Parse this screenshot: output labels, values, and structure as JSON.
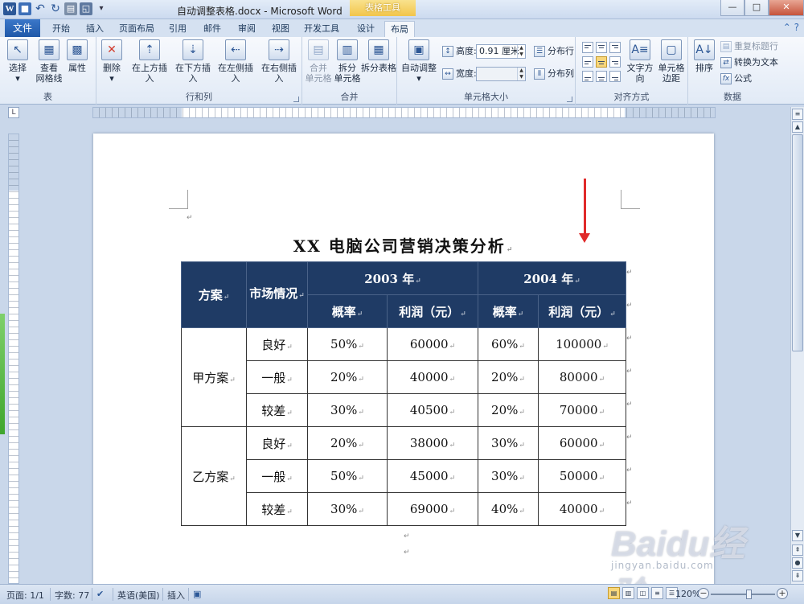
{
  "titlebar": {
    "title": "自动调整表格.docx - Microsoft Word",
    "contextual_tools": "表格工具",
    "app_logo": "W",
    "controls": [
      "—",
      "□",
      "✕"
    ]
  },
  "tabs": {
    "file": "文件",
    "items": [
      "开始",
      "插入",
      "页面布局",
      "引用",
      "邮件",
      "审阅",
      "视图",
      "开发工具",
      "设计",
      "布局"
    ],
    "active": "布局"
  },
  "ribbon": {
    "table": {
      "label": "表",
      "select": "选择",
      "gridlines_l1": "查看",
      "gridlines_l2": "网格线",
      "properties": "属性"
    },
    "rows_cols": {
      "label": "行和列",
      "delete": "删除",
      "insert_above": "在上方插入",
      "insert_below": "在下方插入",
      "insert_left": "在左侧插入",
      "insert_right": "在右侧插入"
    },
    "merge": {
      "label": "合并",
      "merge_cells_l1": "合并",
      "merge_cells_l2": "单元格",
      "split_cells_l1": "拆分",
      "split_cells_l2": "单元格",
      "split_table": "拆分表格"
    },
    "cell_size": {
      "label": "单元格大小",
      "autofit": "自动调整",
      "height_label": "高度:",
      "height_value": "0.91 厘米",
      "width_label": "宽度:",
      "width_value": "",
      "distribute_rows": "分布行",
      "distribute_cols": "分布列"
    },
    "alignment": {
      "label": "对齐方式",
      "text_direction": "文字方向",
      "cell_margins_l1": "单元格",
      "cell_margins_l2": "边距"
    },
    "data": {
      "label": "数据",
      "sort": "排序",
      "repeat_header": "重复标题行",
      "convert_text": "转换为文本",
      "formula": "公式"
    }
  },
  "document": {
    "title": "XX 电脑公司营销决策分析",
    "table": {
      "header_top": [
        "方案",
        "市场情况",
        "2003 年",
        "2004 年"
      ],
      "header_sub": [
        "概率",
        "利润（元）",
        "概率",
        "利润（元）"
      ],
      "groups": [
        {
          "plan": "甲方案",
          "rows": [
            [
              "良好",
              "50%",
              "60000",
              "60%",
              "100000"
            ],
            [
              "一般",
              "20%",
              "40000",
              "20%",
              "80000"
            ],
            [
              "较差",
              "30%",
              "40500",
              "20%",
              "70000"
            ]
          ]
        },
        {
          "plan": "乙方案",
          "rows": [
            [
              "良好",
              "20%",
              "38000",
              "30%",
              "60000"
            ],
            [
              "一般",
              "50%",
              "45000",
              "30%",
              "50000"
            ],
            [
              "较差",
              "30%",
              "69000",
              "40%",
              "40000"
            ]
          ]
        }
      ]
    }
  },
  "statusbar": {
    "page": "页面: 1/1",
    "words": "字数: 77",
    "language": "英语(美国)",
    "mode": "插入",
    "zoom": "120%",
    "zoom_minus": "−",
    "zoom_plus": "+"
  },
  "watermark": {
    "logo": "Baidu经验",
    "url": "jingyan.baidu.com"
  },
  "colors": {
    "header_fill": "#1f3b65",
    "arrow": "#e02a2a",
    "file_tab": "#2a64b4",
    "contextual_tab": "#f2c54b"
  }
}
